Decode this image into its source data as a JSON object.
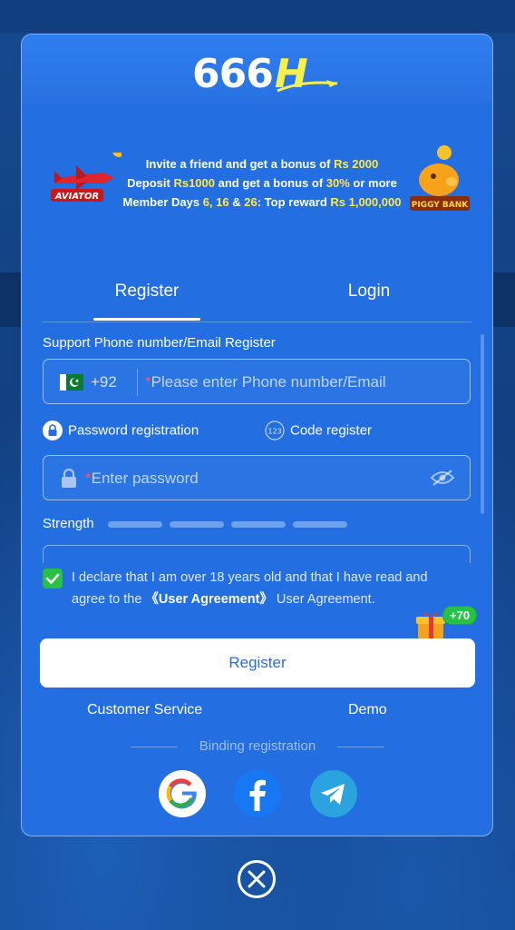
{
  "app": {
    "logo_text": "666",
    "logo_h": "H"
  },
  "promo": {
    "line1_prefix": "Invite a friend and get a bonus of ",
    "line1_value": "Rs 2000",
    "line2_a": "Deposit ",
    "line2_b": "Rs1000",
    "line2_c": " and get a bonus of ",
    "line2_d": "30%",
    "line2_e": " or more",
    "line3_a": "Member Days ",
    "line3_b": "6, 16",
    "line3_c": " & ",
    "line3_d": "26",
    "line3_e": ": Top reward ",
    "line3_f": "Rs 1,000,000",
    "left_game": "AVIATOR",
    "right_game": "PIGGY BANK"
  },
  "tabs": [
    {
      "label": "Register",
      "active": true
    },
    {
      "label": "Login",
      "active": false
    }
  ],
  "form": {
    "section_label": "Support Phone number/Email Register",
    "country_code": "+92",
    "phone_placeholder": "Please enter Phone number/Email",
    "password_registration": "Password registration",
    "code_register": "Code register",
    "password_placeholder": "Enter password",
    "strength_label": "Strength",
    "required_mark": "*"
  },
  "agreement": {
    "checked": true,
    "text_a": "I declare that I am over 18 years old and that I have read and agree to the ",
    "link": "《User Agreement》",
    "text_b": " User Agreement."
  },
  "gift_badge": "+70",
  "register_button": "Register",
  "footer": {
    "customer_service": "Customer Service",
    "demo": "Demo",
    "binding": "Binding registration"
  },
  "colors": {
    "modal_bg": "#236ee0",
    "accent_yellow": "#ffe74c",
    "check_green": "#27c245",
    "button_text": "#2a6ed8"
  },
  "icons": {
    "google": "google-icon",
    "facebook": "facebook-icon",
    "telegram": "telegram-icon",
    "close": "close-icon"
  }
}
